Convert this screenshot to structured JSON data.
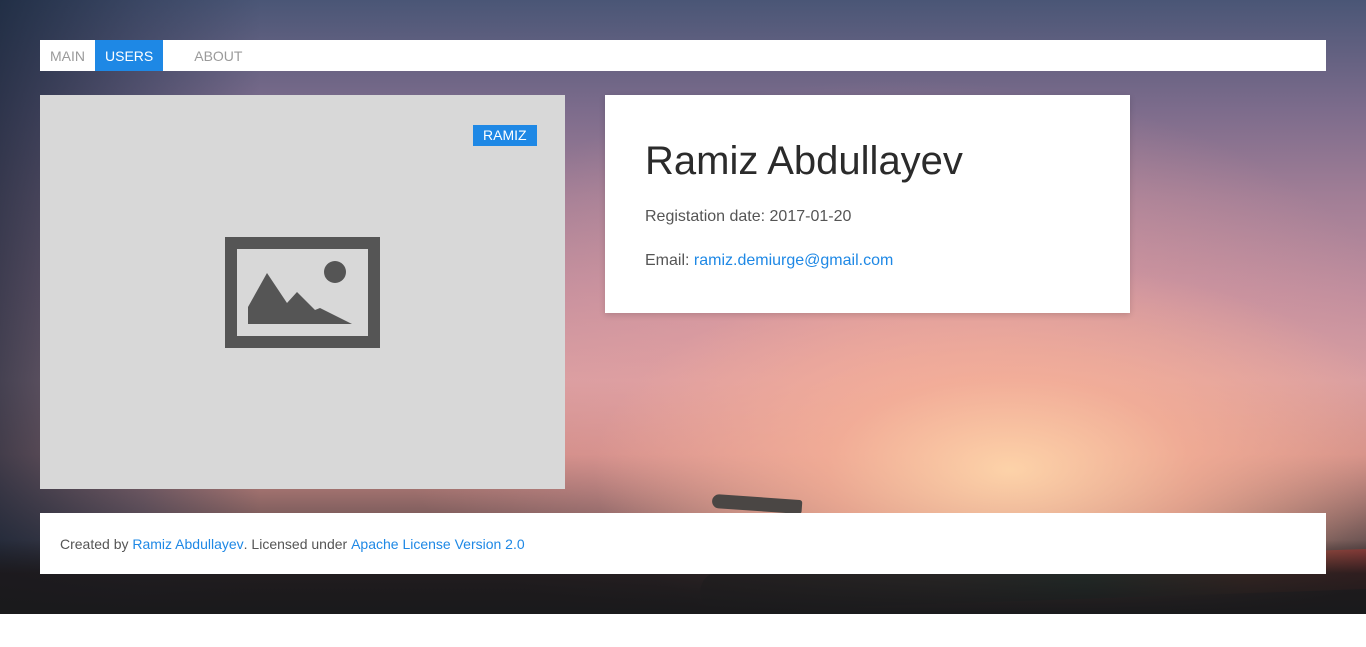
{
  "nav": {
    "items": [
      {
        "label": "MAIN",
        "active": false
      },
      {
        "label": "USERS",
        "active": true
      },
      {
        "label": "ABOUT",
        "active": false
      }
    ]
  },
  "photo": {
    "badge": "RAMIZ",
    "icon": "image-placeholder-icon"
  },
  "profile": {
    "name": "Ramiz Abdullayev",
    "registration_label": "Registation date:",
    "registration_date": "2017-01-20",
    "email_label": "Email:",
    "email": "ramiz.demiurge@gmail.com"
  },
  "footer": {
    "created_by_prefix": "Created by",
    "author_link": "Ramiz Abdullayev",
    "licensed_text": ". Licensed under",
    "license_link": "Apache License Version 2.0"
  },
  "colors": {
    "accent": "#1e88e5",
    "placeholder_bg": "#d8d8d8",
    "placeholder_icon": "#555555"
  }
}
